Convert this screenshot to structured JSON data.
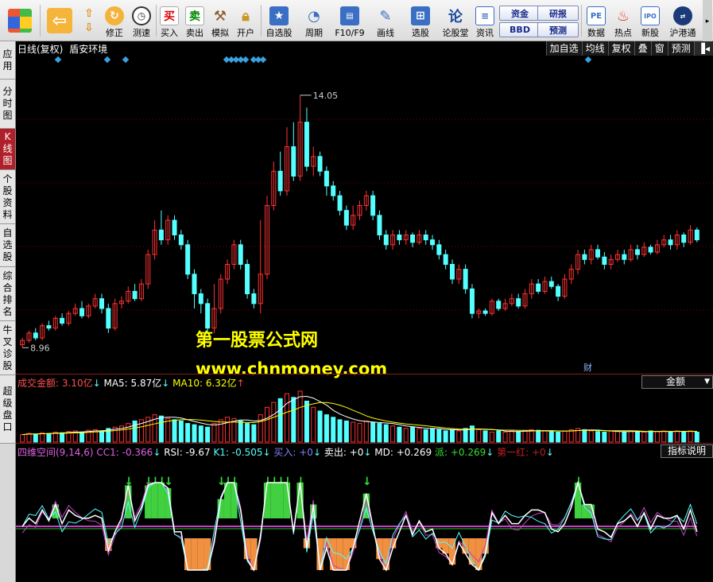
{
  "toolbar": {
    "items": [
      {
        "label": "修正",
        "icon": "refresh-icon"
      },
      {
        "label": "测速",
        "icon": "clock-icon"
      },
      {
        "label": "买入",
        "icon": "buy-icon",
        "glyph": "买"
      },
      {
        "label": "卖出",
        "icon": "sell-icon",
        "glyph": "卖"
      },
      {
        "label": "模拟",
        "icon": "hammer-icon"
      },
      {
        "label": "开户",
        "icon": "lock-icon"
      },
      {
        "label": "自选股",
        "icon": "star-folder-icon"
      },
      {
        "label": "周期",
        "icon": "cycle-icon"
      },
      {
        "label": "F10/F9",
        "icon": "f10-icon"
      },
      {
        "label": "画线",
        "icon": "pen-icon"
      },
      {
        "label": "选股",
        "icon": "select-stock-icon"
      },
      {
        "label": "论股堂",
        "icon": "forum-icon",
        "glyph": "论"
      },
      {
        "label": "资讯",
        "icon": "news-icon"
      },
      {
        "label": "数据",
        "icon": "pe-icon",
        "glyph": "PE"
      },
      {
        "label": "热点",
        "icon": "hot-icon"
      },
      {
        "label": "新股",
        "icon": "ipo-icon",
        "glyph": "IPO"
      },
      {
        "label": "沪港通",
        "icon": "hk-connect-icon"
      }
    ],
    "small_buttons": [
      "资金",
      "BBD",
      "研报",
      "预测"
    ]
  },
  "left_tabs": [
    "应用",
    "分时图",
    "K线图",
    "个股资料",
    "自选股",
    "综合排名",
    "牛叉诊股",
    "超级盘口"
  ],
  "main": {
    "title_period": "日线(复权)",
    "title_indicator": "盾安环境",
    "right_buttons": [
      "加自选",
      "均线",
      "复权",
      "叠",
      "窗",
      "预测"
    ],
    "high_label": "14.05",
    "low_label": "8.96",
    "watermark_line1": "第一股票公式网",
    "watermark_line2": "www.chnmoney.com",
    "finance_marker": "财"
  },
  "volume": {
    "label": "成交金额: 3.10亿",
    "ma5": "MA5: 5.87亿",
    "ma10": "MA10: 6.32亿",
    "dropdown": "金额"
  },
  "indicator": {
    "name": "四维空间(9,14,6)",
    "cc1": "CC1: -0.366",
    "rsi": "RSI: -9.67",
    "k1": "K1: -0.505",
    "buy": "买入: +0",
    "sell": "卖出: +0",
    "md": "MD: +0.269",
    "pai": "派: +0.269",
    "diyi": "第一红: +0",
    "help_button": "指标说明"
  },
  "colors": {
    "up": "#ff3232",
    "down": "#54ffff",
    "grid": "#7a0000",
    "blue_marker": "#3aa0e0",
    "watermark": "#ffff00"
  },
  "chart_data": {
    "type": "candlestick",
    "y_price_range": [
      8.5,
      14.5
    ],
    "candles": [
      [
        8.96,
        9.05,
        9.1,
        8.9
      ],
      [
        9.05,
        9.2,
        9.25,
        9.0
      ],
      [
        9.2,
        9.1,
        9.3,
        9.05
      ],
      [
        9.1,
        9.35,
        9.4,
        9.05
      ],
      [
        9.35,
        9.3,
        9.45,
        9.25
      ],
      [
        9.3,
        9.5,
        9.55,
        9.25
      ],
      [
        9.5,
        9.4,
        9.6,
        9.35
      ],
      [
        9.4,
        9.6,
        9.65,
        9.35
      ],
      [
        9.6,
        9.7,
        9.8,
        9.55
      ],
      [
        9.7,
        9.55,
        9.85,
        9.5
      ],
      [
        9.55,
        9.75,
        9.8,
        9.5
      ],
      [
        9.75,
        9.9,
        10.0,
        9.7
      ],
      [
        9.9,
        9.7,
        10.0,
        9.6
      ],
      [
        9.7,
        9.3,
        9.8,
        9.2
      ],
      [
        9.3,
        9.8,
        9.9,
        9.25
      ],
      [
        9.8,
        9.85,
        9.95,
        9.7
      ],
      [
        9.85,
        10.05,
        10.15,
        9.8
      ],
      [
        10.05,
        9.9,
        10.2,
        9.85
      ],
      [
        9.9,
        10.2,
        10.3,
        9.85
      ],
      [
        10.2,
        10.8,
        10.9,
        10.1
      ],
      [
        10.8,
        11.3,
        11.5,
        10.7
      ],
      [
        11.3,
        11.1,
        11.7,
        11.0
      ],
      [
        11.1,
        11.5,
        11.6,
        11.0
      ],
      [
        11.5,
        11.2,
        11.6,
        11.1
      ],
      [
        11.2,
        11.0,
        11.3,
        10.9
      ],
      [
        11.0,
        10.4,
        11.1,
        10.3
      ],
      [
        10.4,
        10.0,
        10.5,
        9.7
      ],
      [
        10.0,
        9.8,
        10.1,
        9.6
      ],
      [
        9.8,
        9.3,
        9.9,
        9.2
      ],
      [
        9.3,
        9.7,
        10.2,
        9.2
      ],
      [
        9.7,
        10.3,
        10.4,
        9.6
      ],
      [
        10.3,
        10.6,
        10.7,
        10.2
      ],
      [
        10.6,
        11.0,
        11.1,
        10.5
      ],
      [
        11.0,
        10.6,
        11.1,
        10.5
      ],
      [
        10.6,
        10.0,
        10.7,
        9.9
      ],
      [
        10.0,
        9.8,
        10.1,
        9.7
      ],
      [
        9.8,
        10.4,
        11.5,
        9.6
      ],
      [
        10.4,
        11.8,
        12.0,
        10.3
      ],
      [
        11.8,
        12.5,
        12.7,
        11.7
      ],
      [
        12.5,
        12.1,
        12.9,
        12.0
      ],
      [
        12.1,
        13.0,
        13.4,
        12.0
      ],
      [
        13.0,
        12.4,
        13.5,
        12.3
      ],
      [
        12.4,
        13.5,
        14.05,
        12.3
      ],
      [
        13.5,
        12.6,
        13.8,
        12.5
      ],
      [
        12.6,
        12.8,
        13.0,
        12.4
      ],
      [
        12.8,
        12.5,
        12.9,
        12.4
      ],
      [
        12.5,
        12.2,
        12.6,
        12.0
      ],
      [
        12.2,
        12.0,
        12.3,
        11.9
      ],
      [
        12.0,
        11.7,
        12.1,
        11.6
      ],
      [
        11.7,
        11.4,
        11.8,
        11.3
      ],
      [
        11.4,
        11.6,
        11.8,
        11.3
      ],
      [
        11.6,
        11.8,
        11.9,
        11.5
      ],
      [
        11.8,
        12.0,
        12.1,
        11.7
      ],
      [
        12.0,
        11.6,
        12.1,
        11.5
      ],
      [
        11.6,
        11.2,
        11.7,
        11.1
      ],
      [
        11.2,
        11.0,
        11.3,
        10.9
      ],
      [
        11.0,
        11.2,
        11.3,
        10.9
      ],
      [
        11.2,
        11.1,
        11.3,
        11.0
      ],
      [
        11.1,
        11.2,
        11.3,
        11.0
      ],
      [
        11.2,
        11.05,
        11.25,
        10.95
      ],
      [
        11.05,
        11.2,
        11.3,
        11.0
      ],
      [
        11.2,
        11.1,
        11.3,
        11.0
      ],
      [
        11.1,
        11.0,
        11.2,
        10.9
      ],
      [
        11.0,
        10.8,
        11.1,
        10.7
      ],
      [
        10.8,
        10.6,
        10.9,
        10.5
      ],
      [
        10.6,
        10.3,
        10.7,
        10.2
      ],
      [
        10.3,
        10.5,
        10.6,
        10.2
      ],
      [
        10.5,
        10.1,
        10.6,
        10.0
      ],
      [
        10.1,
        9.6,
        10.2,
        9.5
      ],
      [
        9.6,
        9.65,
        9.7,
        9.5
      ],
      [
        9.65,
        9.6,
        9.7,
        9.55
      ],
      [
        9.6,
        9.85,
        9.9,
        9.55
      ],
      [
        9.85,
        9.7,
        9.9,
        9.65
      ],
      [
        9.7,
        9.8,
        9.9,
        9.65
      ],
      [
        9.8,
        9.9,
        10.0,
        9.75
      ],
      [
        9.9,
        9.75,
        10.0,
        9.7
      ],
      [
        9.75,
        10.0,
        10.1,
        9.7
      ],
      [
        10.0,
        10.2,
        10.3,
        9.9
      ],
      [
        10.2,
        10.05,
        10.3,
        10.0
      ],
      [
        10.05,
        10.25,
        10.35,
        10.0
      ],
      [
        10.25,
        10.15,
        10.35,
        10.1
      ],
      [
        10.15,
        9.95,
        10.2,
        9.85
      ],
      [
        9.95,
        10.3,
        10.4,
        9.9
      ],
      [
        10.3,
        10.5,
        10.6,
        10.2
      ],
      [
        10.5,
        10.8,
        10.9,
        10.4
      ],
      [
        10.8,
        10.7,
        10.9,
        10.6
      ],
      [
        10.7,
        10.9,
        11.0,
        10.6
      ],
      [
        10.9,
        10.75,
        11.0,
        10.7
      ],
      [
        10.75,
        10.6,
        10.85,
        10.5
      ],
      [
        10.6,
        10.7,
        10.8,
        10.5
      ],
      [
        10.7,
        10.8,
        10.9,
        10.65
      ],
      [
        10.8,
        10.7,
        10.9,
        10.6
      ],
      [
        10.7,
        10.9,
        11.0,
        10.65
      ],
      [
        10.9,
        10.8,
        11.0,
        10.7
      ],
      [
        10.8,
        10.95,
        11.05,
        10.75
      ],
      [
        10.95,
        10.85,
        11.0,
        10.8
      ],
      [
        10.85,
        11.0,
        11.1,
        10.8
      ],
      [
        11.0,
        11.1,
        11.2,
        10.95
      ],
      [
        11.1,
        11.0,
        11.2,
        10.9
      ],
      [
        11.0,
        11.2,
        11.3,
        10.9
      ],
      [
        11.2,
        11.05,
        11.25,
        10.95
      ],
      [
        11.05,
        11.3,
        11.4,
        11.0
      ],
      [
        11.3,
        11.1,
        11.35,
        11.05
      ]
    ],
    "volume": [
      12,
      14,
      13,
      15,
      14,
      16,
      15,
      17,
      18,
      16,
      19,
      20,
      18,
      22,
      24,
      26,
      30,
      34,
      36,
      40,
      44,
      42,
      38,
      36,
      34,
      30,
      28,
      26,
      24,
      30,
      36,
      40,
      38,
      34,
      30,
      28,
      44,
      56,
      64,
      70,
      78,
      72,
      82,
      66,
      56,
      50,
      44,
      40,
      36,
      34,
      32,
      30,
      34,
      32,
      30,
      28,
      26,
      24,
      22,
      24,
      22,
      20,
      22,
      20,
      18,
      20,
      18,
      22,
      26,
      20,
      18,
      16,
      18,
      16,
      18,
      17,
      18,
      20,
      19,
      18,
      17,
      16,
      18,
      20,
      22,
      20,
      18,
      17,
      16,
      18,
      17,
      16,
      18,
      17,
      16,
      18,
      17,
      18,
      16,
      18,
      17,
      18,
      16
    ]
  }
}
